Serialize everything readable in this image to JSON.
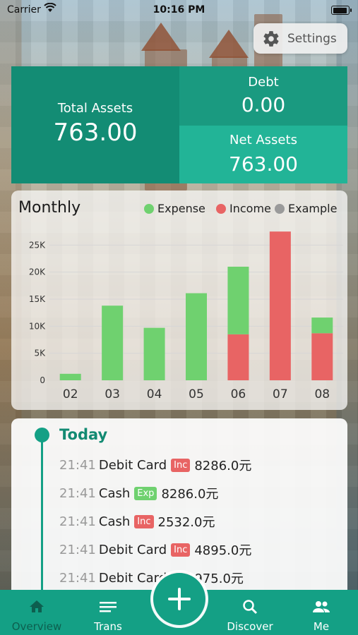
{
  "status": {
    "carrier": "Carrier",
    "time": "10:16 PM"
  },
  "settings": {
    "label": "Settings",
    "icon": "gear-icon"
  },
  "assets": {
    "total_label": "Total Assets",
    "total_value": "763.00",
    "debt_label": "Debt",
    "debt_value": "0.00",
    "net_label": "Net Assets",
    "net_value": "763.00"
  },
  "chart_data": {
    "type": "bar",
    "title": "Monthly",
    "categories": [
      "02",
      "03",
      "04",
      "05",
      "06",
      "07",
      "08"
    ],
    "series": [
      {
        "name": "Expense",
        "color": "#6fd16f",
        "values": [
          1200,
          13800,
          9700,
          16100,
          12500,
          0,
          2900
        ]
      },
      {
        "name": "Income",
        "color": "#e86464",
        "values": [
          0,
          0,
          0,
          0,
          8500,
          27500,
          8700
        ]
      },
      {
        "name": "Example",
        "color": "#9a9a9a",
        "values": [
          0,
          0,
          0,
          0,
          0,
          0,
          0
        ]
      }
    ],
    "stacked": true,
    "yticks": [
      "0",
      "5K",
      "10K",
      "15K",
      "20K",
      "25K"
    ],
    "ylim": [
      0,
      30000
    ],
    "grid": true,
    "legend_position": "top-right"
  },
  "today": {
    "label": "Today",
    "items": [
      {
        "time": "21:41",
        "account": "Debit Card",
        "badge": "Inc",
        "amount": "8286.0元"
      },
      {
        "time": "21:41",
        "account": "Cash",
        "badge": "Exp",
        "amount": "8286.0元"
      },
      {
        "time": "21:41",
        "account": "Cash",
        "badge": "Inc",
        "amount": "2532.0元"
      },
      {
        "time": "21:41",
        "account": "Debit Card",
        "badge": "Inc",
        "amount": "4895.0元"
      },
      {
        "time": "21:41",
        "account": "Debit Card",
        "badge": "Inc",
        "amount": "975.0元"
      }
    ]
  },
  "tabs": [
    {
      "label": "Overview",
      "icon": "home-icon",
      "active": true
    },
    {
      "label": "Trans",
      "icon": "list-icon",
      "active": false
    },
    {
      "label": "Discover",
      "icon": "search-icon",
      "active": false
    },
    {
      "label": "Me",
      "icon": "people-icon",
      "active": false
    }
  ],
  "colors": {
    "primary": "#14a085",
    "income": "#e86464",
    "expense": "#6fd16f"
  }
}
